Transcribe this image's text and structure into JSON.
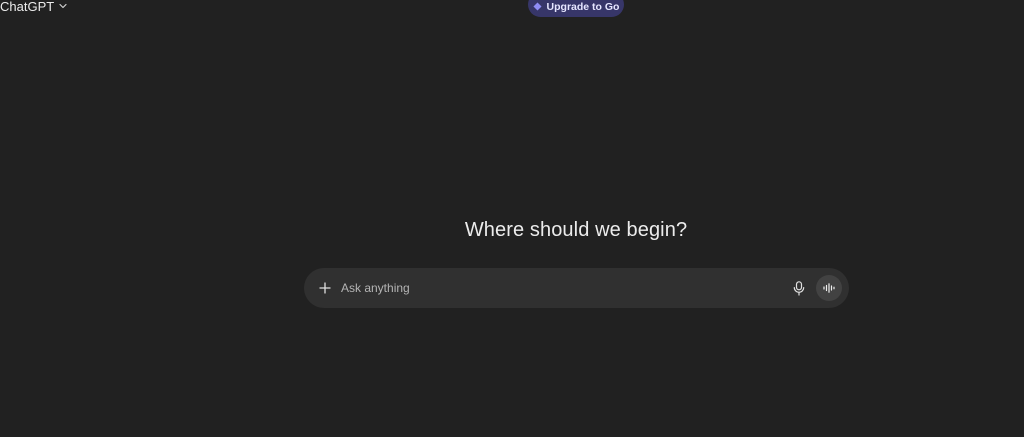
{
  "header": {
    "model_name": "ChatGPT",
    "upgrade_label": "Upgrade to Go"
  },
  "main": {
    "headline": "Where should we begin?"
  },
  "composer": {
    "placeholder": "Ask anything",
    "value": ""
  },
  "icons": {
    "model_dropdown": "chevron-down-icon",
    "upgrade": "diamond-icon",
    "add": "plus-icon",
    "dictate": "microphone-icon",
    "voice_mode": "waveform-icon"
  },
  "colors": {
    "background": "#212121",
    "composer": "#303030",
    "upgrade_button": "#373669",
    "upgrade_icon": "#8f8cf5",
    "voice_button": "#424242",
    "text": "#ececec",
    "placeholder": "#b4b4b4"
  }
}
